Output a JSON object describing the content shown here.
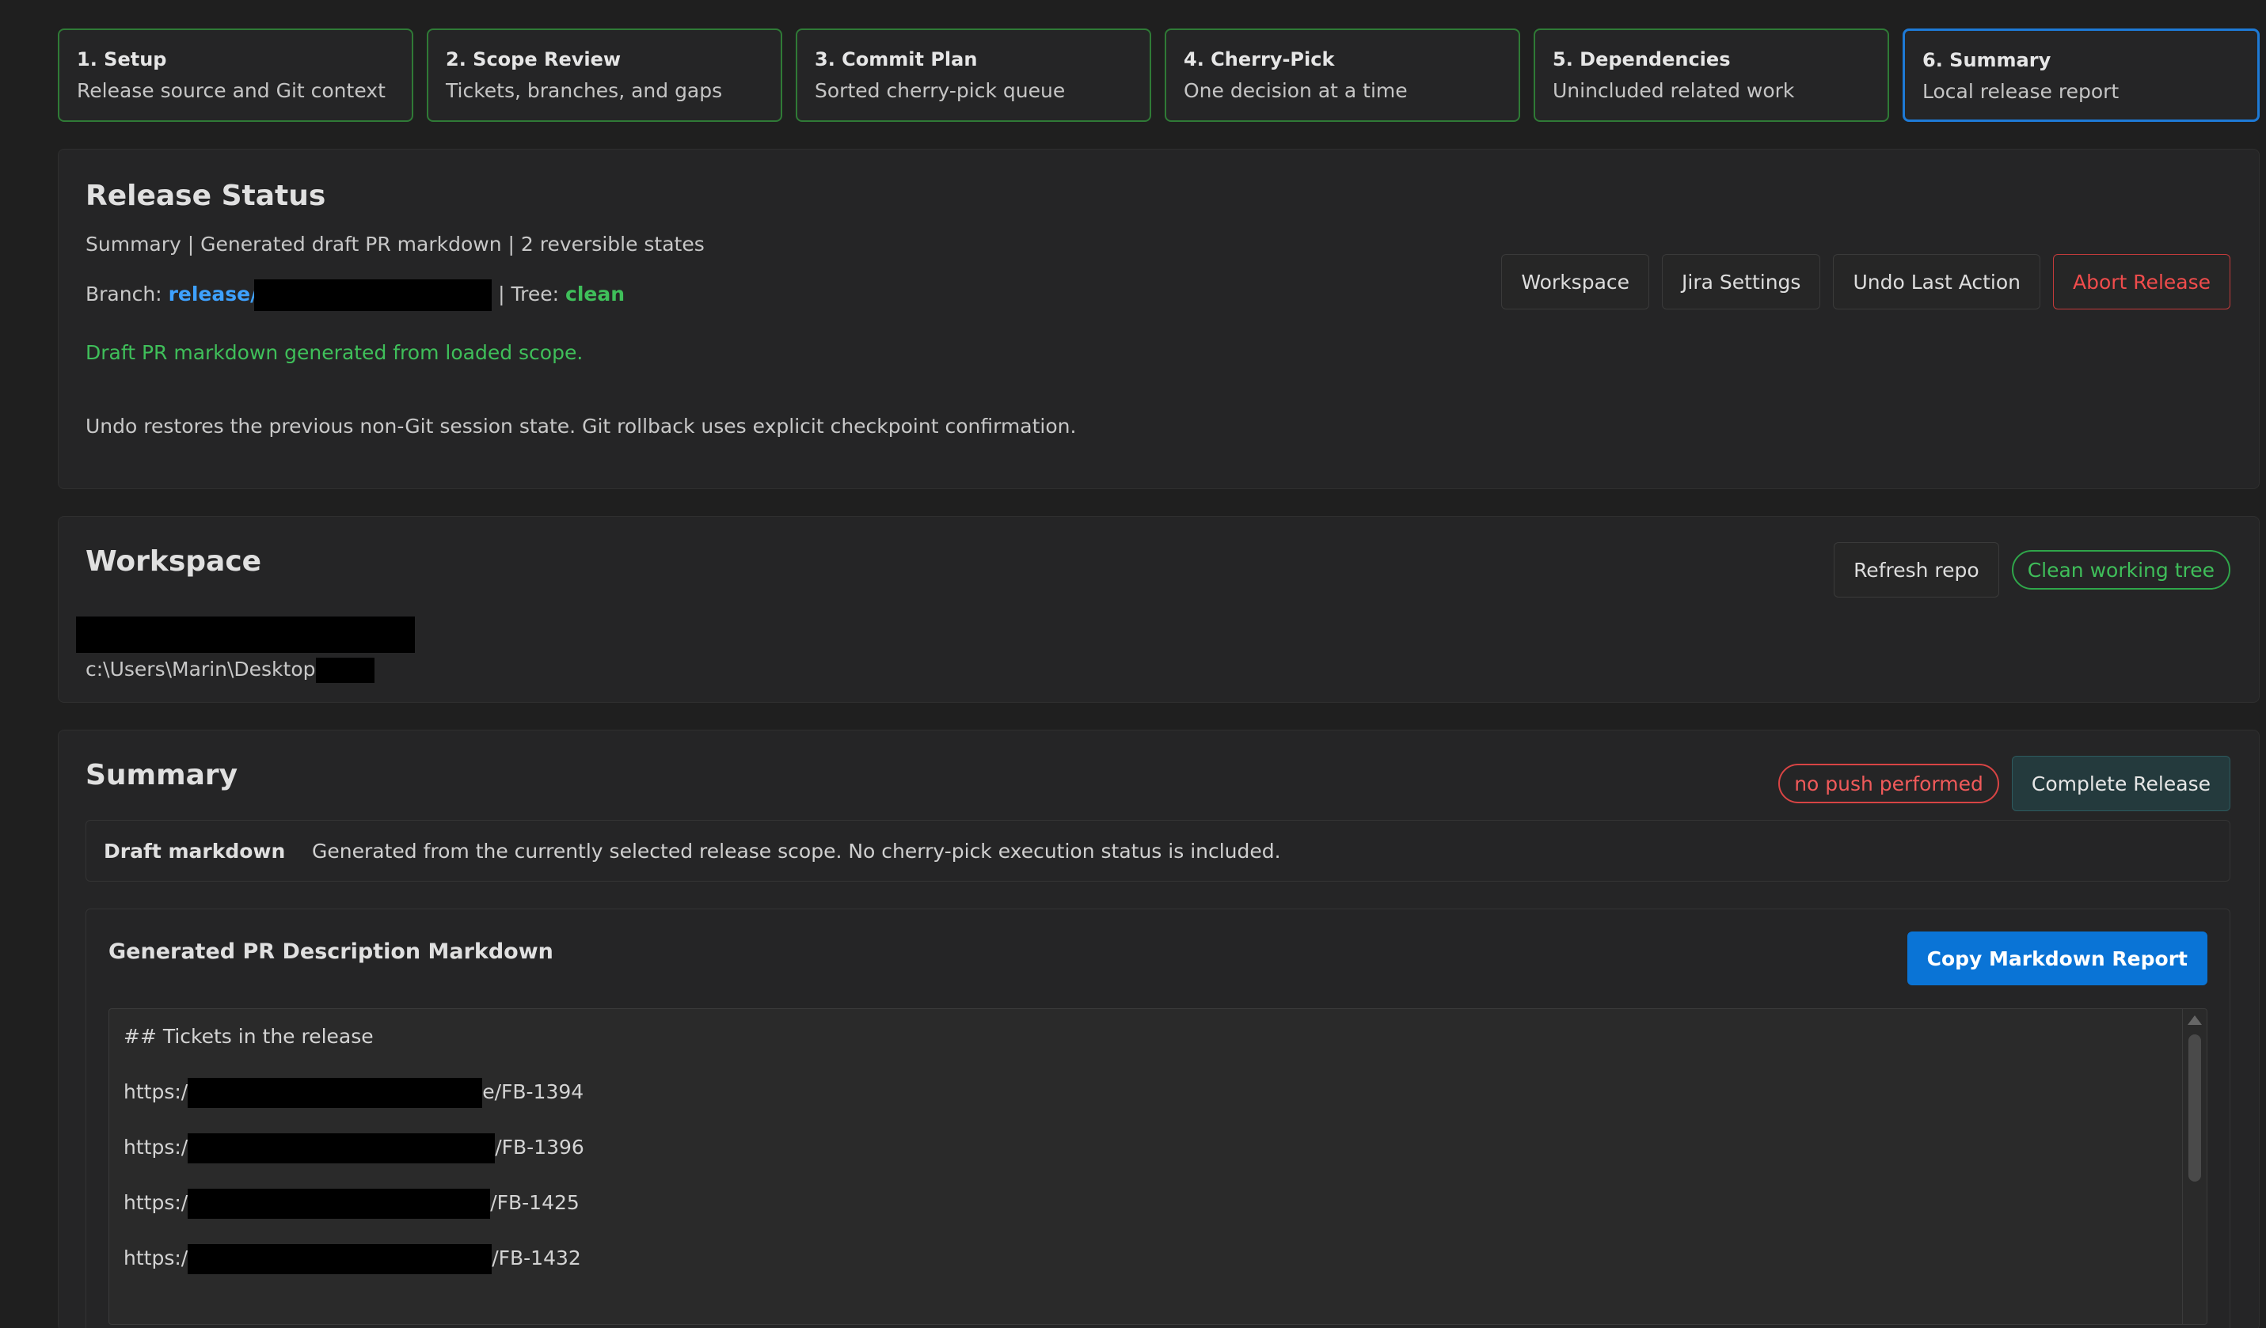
{
  "steps": [
    {
      "title": "1. Setup",
      "subtitle": "Release source and Git context"
    },
    {
      "title": "2. Scope Review",
      "subtitle": "Tickets, branches, and gaps"
    },
    {
      "title": "3. Commit Plan",
      "subtitle": "Sorted cherry-pick queue"
    },
    {
      "title": "4. Cherry-Pick",
      "subtitle": "One decision at a time"
    },
    {
      "title": "5. Dependencies",
      "subtitle": "Unincluded related work"
    },
    {
      "title": "6. Summary",
      "subtitle": "Local release report"
    }
  ],
  "release_status": {
    "title": "Release Status",
    "summary_line": "Summary | Generated draft PR markdown | 2 reversible states",
    "branch_label": "Branch:",
    "branch_value": "release/",
    "tree_label": "| Tree:",
    "tree_value": "clean",
    "success_message": "Draft PR markdown generated from loaded scope.",
    "undo_note": "Undo restores the previous non-Git session state. Git rollback uses explicit checkpoint confirmation.",
    "buttons": {
      "workspace": "Workspace",
      "jira_settings": "Jira Settings",
      "undo": "Undo Last Action",
      "abort": "Abort Release"
    }
  },
  "workspace": {
    "title": "Workspace",
    "refresh_button": "Refresh repo",
    "status_badge": "Clean working tree",
    "path": "c:\\Users\\Marin\\Desktop"
  },
  "summary": {
    "title": "Summary",
    "push_badge": "no push performed",
    "complete_button": "Complete Release",
    "draft_label": "Draft markdown",
    "draft_text": "Generated from the currently selected release scope. No cherry-pick execution status is included.",
    "markdown_title": "Generated PR Description Markdown",
    "copy_button": "Copy Markdown Report",
    "lines": [
      {
        "prefix": "## Tickets in the release",
        "suffix": ""
      },
      {
        "prefix": "https:/",
        "suffix": "e/FB-1394"
      },
      {
        "prefix": "https:/",
        "suffix": "/FB-1396"
      },
      {
        "prefix": "https:/",
        "suffix": "/FB-1425"
      },
      {
        "prefix": "https:/",
        "suffix": "/FB-1432"
      }
    ]
  },
  "colors": {
    "accent_blue": "#0a74d6",
    "success_green": "#3fbf5a",
    "danger_red": "#f04c4c",
    "step_border": "#2f7a36"
  }
}
